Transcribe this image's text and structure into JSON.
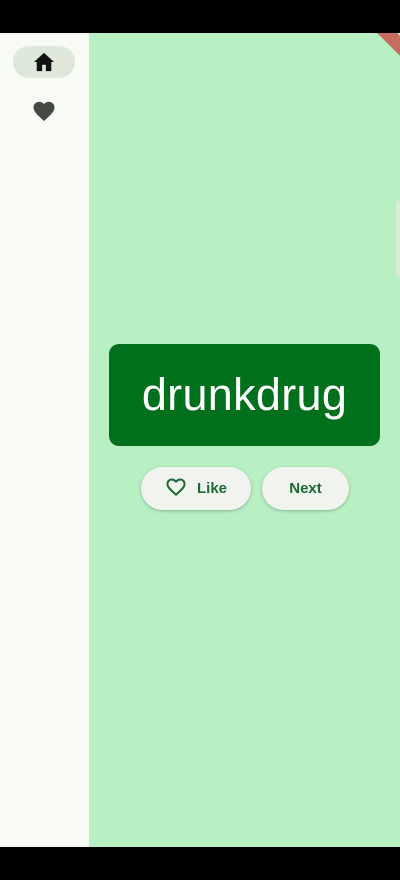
{
  "navigation_rail": {
    "items": [
      {
        "icon": "home-icon",
        "selected": true
      },
      {
        "icon": "heart-icon",
        "selected": false
      }
    ]
  },
  "main": {
    "word": "drunkdrug",
    "like_button": {
      "label": "Like",
      "icon": "heart-outline-icon"
    },
    "next_button": {
      "label": "Next"
    }
  },
  "colors": {
    "rail_background": "#f7fbf3",
    "main_background": "#b8efc3",
    "card_background": "#00701d",
    "button_text": "#1a6a32"
  }
}
